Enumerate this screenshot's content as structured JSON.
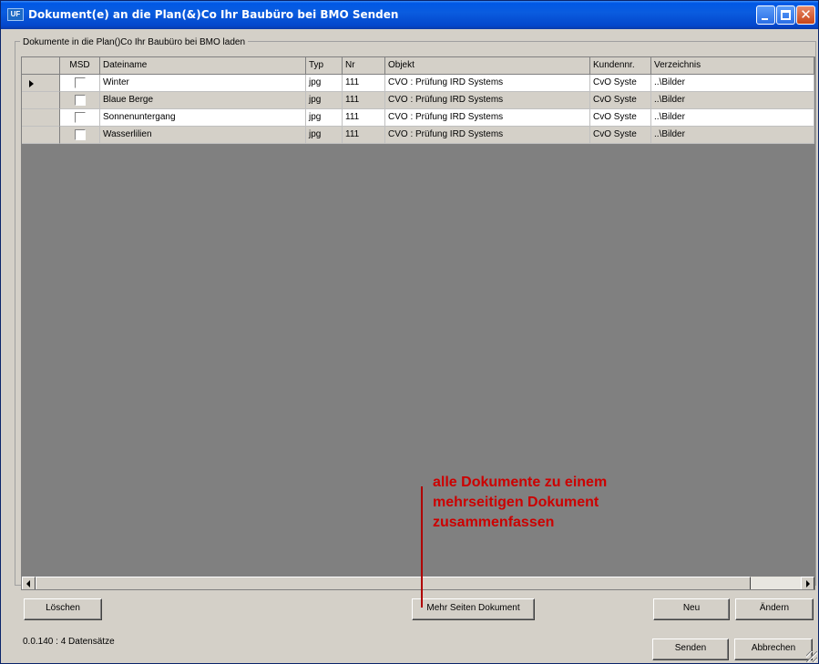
{
  "window": {
    "title": "Dokument(e) an die Plan(&)Co Ihr Baubüro bei BMO Senden",
    "app_icon_text": "UF",
    "close_glyph": "✕"
  },
  "group": {
    "label": "Dokumente in die Plan()Co Ihr Baubüro bei BMO laden"
  },
  "grid": {
    "columns": [
      "MSD",
      "Dateiname",
      "Typ",
      "Nr",
      "Objekt",
      "Kundennr.",
      "Verzeichnis"
    ],
    "rows": [
      {
        "dateiname": "Winter",
        "typ": "jpg",
        "nr": "111",
        "objekt": "CVO : Prüfung IRD Systems",
        "kundennr": "CvO Syste",
        "verzeichnis": "..\\Bilder",
        "msd": false,
        "current": true
      },
      {
        "dateiname": "Blaue Berge",
        "typ": "jpg",
        "nr": "111",
        "objekt": "CVO : Prüfung IRD Systems",
        "kundennr": "CvO Syste",
        "verzeichnis": "..\\Bilder",
        "msd": false,
        "current": false
      },
      {
        "dateiname": "Sonnenuntergang",
        "typ": "jpg",
        "nr": "111",
        "objekt": "CVO : Prüfung IRD Systems",
        "kundennr": "CvO Syste",
        "verzeichnis": "..\\Bilder",
        "msd": false,
        "current": false
      },
      {
        "dateiname": "Wasserlilien",
        "typ": "jpg",
        "nr": "111",
        "objekt": "CVO : Prüfung IRD Systems",
        "kundennr": "CvO Syste",
        "verzeichnis": "..\\Bilder",
        "msd": false,
        "current": false
      }
    ]
  },
  "buttons": {
    "loeschen": "Löschen",
    "mehr_seiten": "Mehr Seiten Dokument",
    "neu": "Neu",
    "aendern": "Ändern",
    "senden": "Senden",
    "abbrechen": "Abbrechen"
  },
  "status": {
    "text": "0.0.140 : 4 Datensätze"
  },
  "annotation": {
    "lines": [
      "alle Dokumente zu einem",
      "mehrseitigen Dokument",
      "zusammenfassen"
    ],
    "color": "#cc0000"
  },
  "colors": {
    "title_bar": "#0a5cdf",
    "dialog_bg": "#d4d0c8",
    "grid_empty": "#808080"
  }
}
